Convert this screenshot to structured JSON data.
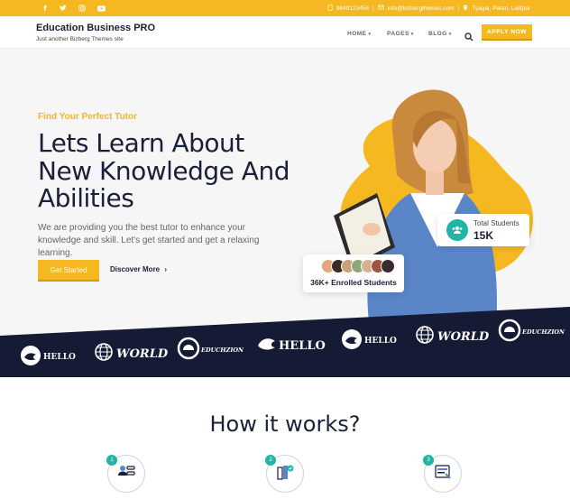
{
  "topbar": {
    "social_icons": [
      "facebook-icon",
      "twitter-icon",
      "instagram-icon",
      "youtube-icon"
    ],
    "phone": "9849123456",
    "email": "info@bizbergthemes.com",
    "location": "Tyagal, Patan, Lalitpur"
  },
  "header": {
    "site_title": "Education Business PRO",
    "tagline": "Just another Bizberg Themes site",
    "nav": [
      "HOME",
      "PAGES",
      "BLOG"
    ],
    "apply_label": "APPLY NOW"
  },
  "hero": {
    "eyebrow": "Find Your Perfect Tutor",
    "headline_line1": "Lets Learn About",
    "headline_line2": "New Knowledge And",
    "headline_line3": "Abilities",
    "description": "We are providing you the best tutor to enhance your knowledge and skill. Let's get started and get a relaxing learning.",
    "cta_primary": "Get Started",
    "cta_secondary": "Discover More",
    "students_label": "Total Students",
    "students_value": "15K",
    "enrolled_label": "36K+ Enrolled Students"
  },
  "logos": [
    {
      "text": "HELLO",
      "icon": "fish-icon"
    },
    {
      "text": "WORLD",
      "icon": "globe-icon"
    },
    {
      "text": "EDUCHZION",
      "icon": "chat-bubble-icon"
    },
    {
      "text": "HELLO",
      "icon": "fish-icon"
    },
    {
      "text": "HELLO",
      "icon": "fish-icon"
    },
    {
      "text": "WORLD",
      "icon": "globe-icon"
    },
    {
      "text": "EDUCHZION",
      "icon": "chat-bubble-icon"
    }
  ],
  "how": {
    "title": "How it works?",
    "steps": [
      {
        "num": "1",
        "icon": "profile-list-icon"
      },
      {
        "num": "2",
        "icon": "books-icon"
      },
      {
        "num": "3",
        "icon": "certificate-icon"
      }
    ]
  },
  "colors": {
    "accent": "#f5b820",
    "teal": "#21b5a5",
    "navy": "#1a1f3a"
  }
}
